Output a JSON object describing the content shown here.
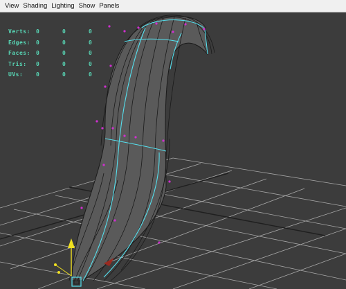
{
  "menu": {
    "items": [
      "View",
      "Shading",
      "Lighting",
      "Show",
      "Panels"
    ]
  },
  "hud": {
    "rows": [
      {
        "label": "Verts:",
        "values": [
          "0",
          "0",
          "0"
        ]
      },
      {
        "label": "Edges:",
        "values": [
          "0",
          "0",
          "0"
        ]
      },
      {
        "label": "Faces:",
        "values": [
          "0",
          "0",
          "0"
        ]
      },
      {
        "label": "Tris:",
        "values": [
          "0",
          "0",
          "0"
        ]
      },
      {
        "label": "UVs:",
        "values": [
          "0",
          "0",
          "0"
        ]
      }
    ]
  },
  "colors": {
    "viewport_bg": "#3c3c3c",
    "grid_line": "#a8a8a8",
    "grid_axis": "#1f1f1f",
    "mesh_fill": "#5a5a5a",
    "wire": "#1a1a1a",
    "highlight_edge": "#55e0ee",
    "vertex": "#d030d0",
    "hud_text": "#58d7b6",
    "manipulator_yellow": "#f0e020"
  },
  "icons": {
    "manipulator": "move-manipulator-icon",
    "pivot": "pivot-icon"
  }
}
